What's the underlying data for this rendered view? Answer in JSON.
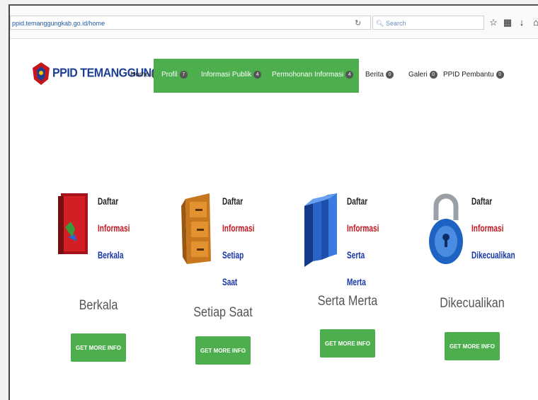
{
  "browser": {
    "url": "ppid.temanggungkab.go.id/home",
    "search_placeholder": "Search",
    "reload_icon": "reload-icon"
  },
  "site": {
    "logo_text": "PPID TEMANGGUNG",
    "nav": [
      {
        "label": "Home",
        "badge": "0"
      },
      {
        "label": "Profil",
        "badge": "7"
      },
      {
        "label": "Informasi Publik",
        "badge": "4"
      },
      {
        "label": "Permohonan Informasi",
        "badge": "4"
      },
      {
        "label": "Berita",
        "badge": "0"
      },
      {
        "label": "Galeri",
        "badge": "0"
      },
      {
        "label": "PPID Pembantu",
        "badge": "0"
      }
    ]
  },
  "cards": [
    {
      "cap": [
        "Daftar",
        "Informasi",
        "Berkala"
      ],
      "title": "Berkala",
      "button": "GET MORE INFO"
    },
    {
      "cap": [
        "Daftar",
        "Informasi",
        "Setiap Saat"
      ],
      "title": "Setiap Saat",
      "button": "GET MORE INFO"
    },
    {
      "cap": [
        "Daftar",
        "Informasi",
        "Serta Merta"
      ],
      "title": "Serta Merta",
      "button": "GET MORE INFO"
    },
    {
      "cap": [
        "Daftar",
        "Informasi",
        "Dikecualikan"
      ],
      "title": "Dikecualikan",
      "button": "GET MORE INFO"
    }
  ],
  "colors": {
    "accent": "#4cae4c",
    "caption_red": "#c4161c",
    "caption_blue": "#1836a8"
  }
}
